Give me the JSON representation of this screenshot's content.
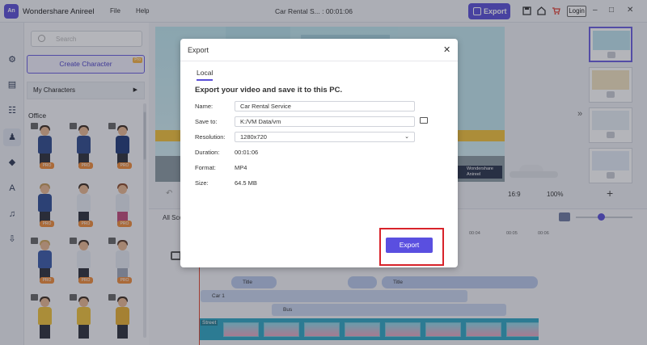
{
  "app": {
    "title": "Wondershare Anireel",
    "logo_text": "An",
    "menu": [
      "File",
      "Help"
    ],
    "doc_title": "Car Rental S... : 00:01:06",
    "export_label": "Export",
    "login_label": "Login",
    "window_buttons": [
      "–",
      "□",
      "✕"
    ]
  },
  "left_panel": {
    "search_placeholder": "Search",
    "create_character_label": "Create Character",
    "create_badge": "Pro",
    "my_characters_label": "My Characters",
    "category": "Office",
    "pro_badge": "PRO"
  },
  "preview": {
    "badge": "Wondershare Anireel",
    "aspect_ratio": "16:9",
    "zoom": "100%"
  },
  "timeline": {
    "all_scenes_label": "All Sce",
    "ruler": [
      "00:04",
      "00:05",
      "00:06"
    ],
    "tracks": {
      "title1": "Title",
      "title2": "Title",
      "car": "Car 1",
      "bus": "Bus",
      "street": "Street"
    }
  },
  "export_dialog": {
    "title": "Export",
    "tab": "Local",
    "heading": "Export your video and save it to this PC.",
    "name_label": "Name:",
    "name_value": "Car Rental Service",
    "save_label": "Save to:",
    "save_value": "K:/VM Data/vm",
    "resolution_label": "Resolution:",
    "resolution_value": "1280x720",
    "duration_label": "Duration:",
    "duration_value": "00:01:06",
    "format_label": "Format:",
    "format_value": "MP4",
    "size_label": "Size:",
    "size_value": "64.5 MB",
    "export_button": "Export"
  },
  "colors": {
    "accent": "#5a4fd8",
    "highlight_frame": "#d8232a",
    "pro_badge": "#f08c3a"
  }
}
